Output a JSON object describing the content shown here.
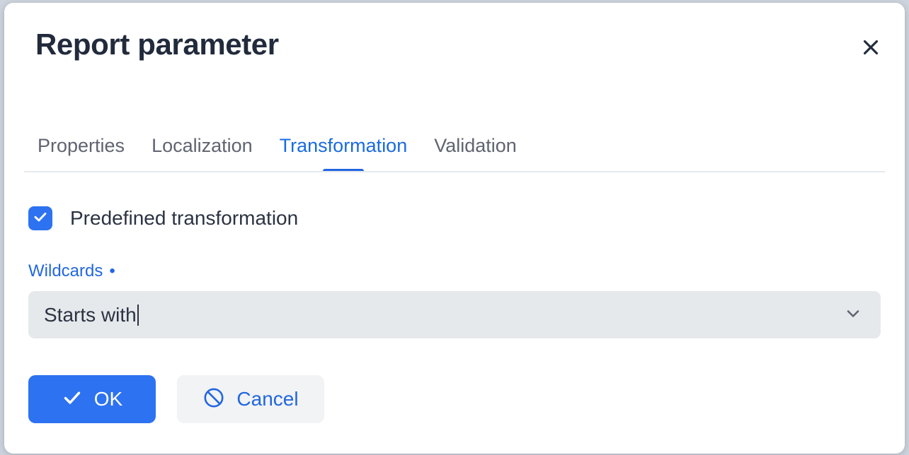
{
  "dialog": {
    "title": "Report parameter",
    "close_label": "×",
    "close_icon": "close-icon"
  },
  "tabs": [
    {
      "label": "Properties",
      "active": false
    },
    {
      "label": "Localization",
      "active": false
    },
    {
      "label": "Transformation",
      "active": true
    },
    {
      "label": "Validation",
      "active": false
    }
  ],
  "form": {
    "checkbox": {
      "label": "Predefined transformation",
      "checked": true,
      "icon": "checkmark-icon"
    },
    "wildcards": {
      "label": "Wildcards",
      "required_marker": "•",
      "value": "Starts with",
      "has_caret": true,
      "dropdown_icon": "chevron-down-icon"
    }
  },
  "buttons": {
    "ok": {
      "label": "OK",
      "icon": "checkmark-icon"
    },
    "cancel": {
      "label": "Cancel",
      "icon": "block-circle-icon"
    }
  },
  "colors": {
    "accent_blue": "#2266e0",
    "primary_button": "#2d72f0",
    "text_dark": "#2b3342",
    "text_muted": "#5f6471",
    "field_bg": "#e6e9ec",
    "cancel_bg": "#f1f3f4",
    "rule": "#e6e9ee"
  }
}
